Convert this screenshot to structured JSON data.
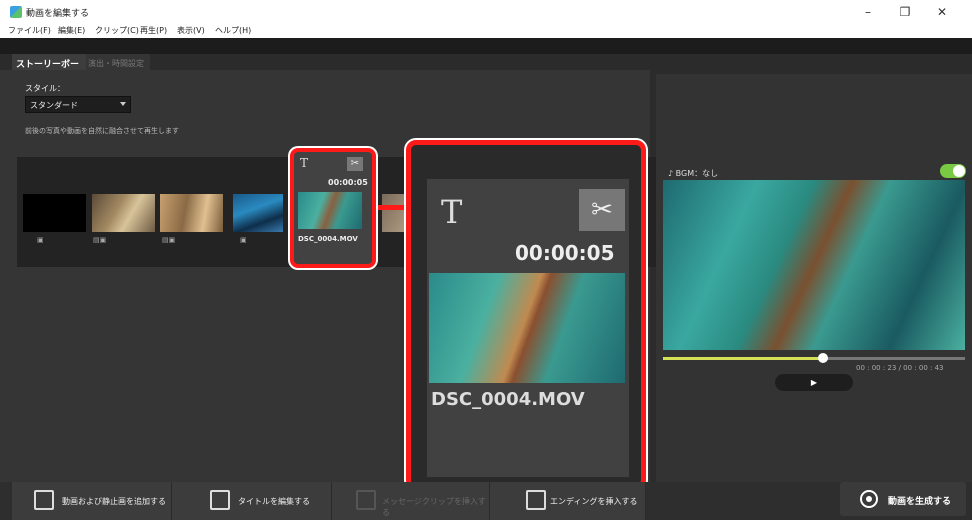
{
  "window": {
    "title": "動画を編集する",
    "minimize": "–",
    "restore": "❐",
    "close": "✕"
  },
  "menu": [
    "ファイル(F)",
    "編集(E)",
    "クリップ(C)",
    "再生(P)",
    "表示(V)",
    "ヘルプ(H)"
  ],
  "tabs": {
    "storyboard": "ストーリーボード",
    "effects": "演出・時間設定"
  },
  "style": {
    "label": "スタイル：",
    "selected": "スタンダード",
    "description": "前後の写真や動画を自然に融合させて再生します"
  },
  "clip": {
    "title_icon": "T",
    "cut_icon": "✂",
    "duration": "00:00:05",
    "filename": "DSC_0004.MOV"
  },
  "preview": {
    "bgm": "♪ BGM：なし",
    "timecode": "00 : 00 : 23 / 00 : 00 : 43",
    "play": "▶",
    "progress": 0.53
  },
  "bottom": {
    "add_media": "動画および静止画を追加する",
    "edit_title": "タイトルを編集する",
    "insert_message": "メッセージクリップを挿入する",
    "insert_ending": "エンディングを挿入する",
    "generate": "動画を生成する"
  },
  "colors": {
    "highlight": "#ff1a1a",
    "toggle_on": "#7ac943",
    "seek": "#d4e157"
  }
}
